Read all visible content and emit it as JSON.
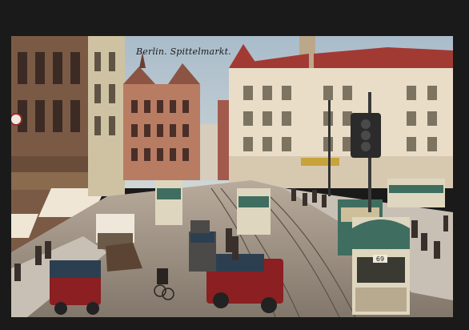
{
  "postcard": {
    "caption": "Berlin. Spittelmarkt.",
    "tram_route_number": "69",
    "shop_sign": "",
    "colors": {
      "sky": "#b9c8d2",
      "palace_red_roof": "#a23a34",
      "palace_wall": "#e9ddc8",
      "street": "#9c8f84",
      "car_red": "#8b1f22",
      "car_blue_top": "#2c3f50",
      "tram_green": "#3f6e60",
      "tram_cream": "#dfd6bf"
    },
    "icons": [
      "traffic-light-icon",
      "streetlamp-icon",
      "horse-cart-icon"
    ]
  }
}
